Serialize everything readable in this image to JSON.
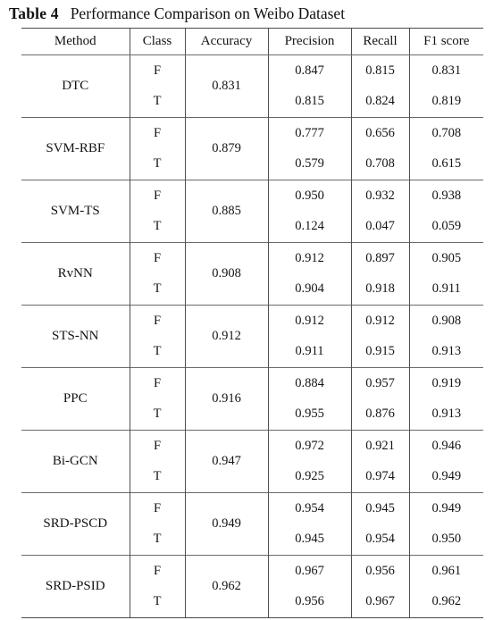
{
  "caption": {
    "label": "Table 4",
    "text": "Performance Comparison on Weibo Dataset"
  },
  "table": {
    "headers": [
      "Method",
      "Class",
      "Accuracy",
      "Precision",
      "Recall",
      "F1 score"
    ],
    "class_labels": [
      "F",
      "T"
    ],
    "rows": [
      {
        "method": "DTC",
        "method_bold": false,
        "accuracy": "0.831",
        "accuracy_bold": false,
        "f": {
          "precision": "0.847",
          "recall": "0.815",
          "f1": "0.831"
        },
        "t": {
          "precision": "0.815",
          "recall": "0.824",
          "f1": "0.819"
        },
        "f_bold": {
          "precision": false,
          "recall": false,
          "f1": false
        },
        "t_bold": {
          "precision": false,
          "recall": false,
          "f1": false
        }
      },
      {
        "method": "SVM-RBF",
        "method_bold": false,
        "accuracy": "0.879",
        "accuracy_bold": false,
        "f": {
          "precision": "0.777",
          "recall": "0.656",
          "f1": "0.708"
        },
        "t": {
          "precision": "0.579",
          "recall": "0.708",
          "f1": "0.615"
        },
        "f_bold": {
          "precision": false,
          "recall": false,
          "f1": false
        },
        "t_bold": {
          "precision": false,
          "recall": false,
          "f1": false
        }
      },
      {
        "method": "SVM-TS",
        "method_bold": false,
        "accuracy": "0.885",
        "accuracy_bold": false,
        "f": {
          "precision": "0.950",
          "recall": "0.932",
          "f1": "0.938"
        },
        "t": {
          "precision": "0.124",
          "recall": "0.047",
          "f1": "0.059"
        },
        "f_bold": {
          "precision": false,
          "recall": false,
          "f1": false
        },
        "t_bold": {
          "precision": false,
          "recall": false,
          "f1": false
        }
      },
      {
        "method": "RvNN",
        "method_bold": false,
        "accuracy": "0.908",
        "accuracy_bold": false,
        "f": {
          "precision": "0.912",
          "recall": "0.897",
          "f1": "0.905"
        },
        "t": {
          "precision": "0.904",
          "recall": "0.918",
          "f1": "0.911"
        },
        "f_bold": {
          "precision": false,
          "recall": false,
          "f1": false
        },
        "t_bold": {
          "precision": false,
          "recall": false,
          "f1": false
        }
      },
      {
        "method": "STS-NN",
        "method_bold": false,
        "accuracy": "0.912",
        "accuracy_bold": false,
        "f": {
          "precision": "0.912",
          "recall": "0.912",
          "f1": "0.908"
        },
        "t": {
          "precision": "0.911",
          "recall": "0.915",
          "f1": "0.913"
        },
        "f_bold": {
          "precision": false,
          "recall": false,
          "f1": false
        },
        "t_bold": {
          "precision": false,
          "recall": false,
          "f1": false
        }
      },
      {
        "method": "PPC",
        "method_bold": false,
        "accuracy": "0.916",
        "accuracy_bold": false,
        "f": {
          "precision": "0.884",
          "recall": "0.957",
          "f1": "0.919"
        },
        "t": {
          "precision": "0.955",
          "recall": "0.876",
          "f1": "0.913"
        },
        "f_bold": {
          "precision": false,
          "recall": false,
          "f1": false
        },
        "t_bold": {
          "precision": false,
          "recall": false,
          "f1": false
        }
      },
      {
        "method": "Bi-GCN",
        "method_bold": false,
        "accuracy": "0.947",
        "accuracy_bold": false,
        "f": {
          "precision": "0.972",
          "recall": "0.921",
          "f1": "0.946"
        },
        "t": {
          "precision": "0.925",
          "recall": "0.974",
          "f1": "0.949"
        },
        "f_bold": {
          "precision": true,
          "recall": false,
          "f1": false
        },
        "t_bold": {
          "precision": false,
          "recall": true,
          "f1": false
        }
      },
      {
        "method": "SRD-PSCD",
        "method_bold": true,
        "accuracy": "0.949",
        "accuracy_bold": false,
        "f": {
          "precision": "0.954",
          "recall": "0.945",
          "f1": "0.949"
        },
        "t": {
          "precision": "0.945",
          "recall": "0.954",
          "f1": "0.950"
        },
        "f_bold": {
          "precision": false,
          "recall": false,
          "f1": false
        },
        "t_bold": {
          "precision": false,
          "recall": false,
          "f1": false
        }
      },
      {
        "method": "SRD-PSID",
        "method_bold": true,
        "accuracy": "0.962",
        "accuracy_bold": true,
        "f": {
          "precision": "0.967",
          "recall": "0.956",
          "f1": "0.961"
        },
        "t": {
          "precision": "0.956",
          "recall": "0.967",
          "f1": "0.962"
        },
        "f_bold": {
          "precision": false,
          "recall": true,
          "f1": true
        },
        "t_bold": {
          "precision": true,
          "recall": false,
          "f1": true
        }
      }
    ]
  }
}
